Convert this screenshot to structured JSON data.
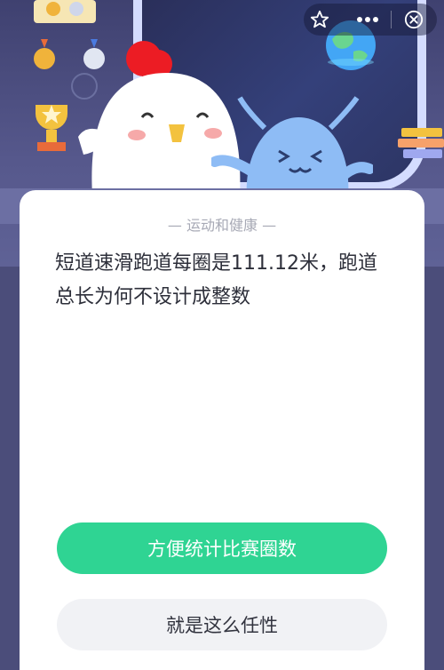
{
  "header": {
    "favorite_icon": "star-outline-icon",
    "more_icon": "more-dots-icon",
    "close_icon": "close-icon"
  },
  "quiz": {
    "category": "— 运动和健康 —",
    "question": "短道速滑跑道每圈是111.12米，跑道总长为何不设计成整数",
    "options": [
      {
        "label": "方便统计比赛圈数"
      },
      {
        "label": "就是这么任性"
      }
    ]
  },
  "colors": {
    "primary_button": "#2fd493",
    "secondary_button": "#f1f2f5",
    "background": "#4b4d7a"
  }
}
